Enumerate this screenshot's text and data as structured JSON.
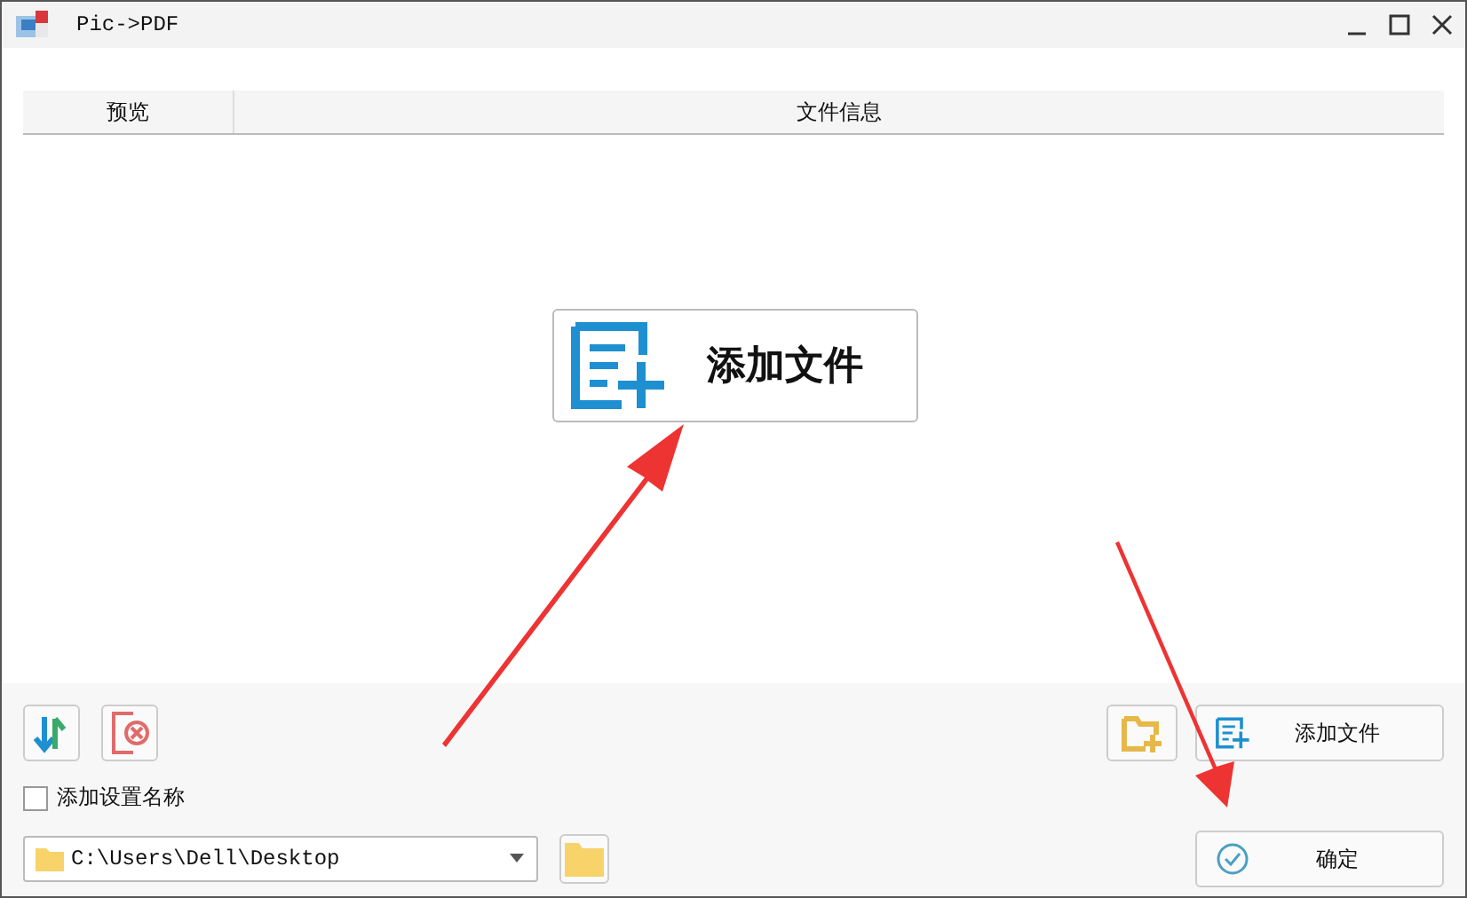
{
  "window": {
    "title": "Pic->PDF"
  },
  "table": {
    "columns": [
      "预览",
      "文件信息"
    ]
  },
  "center_button": {
    "label": "添加文件"
  },
  "add_file_button": {
    "label": "添加文件"
  },
  "name_option": {
    "label": "添加设置名称",
    "checked": false
  },
  "output_path": {
    "value": "C:\\Users\\Dell\\Desktop"
  },
  "confirm_button": {
    "label": "确定"
  }
}
